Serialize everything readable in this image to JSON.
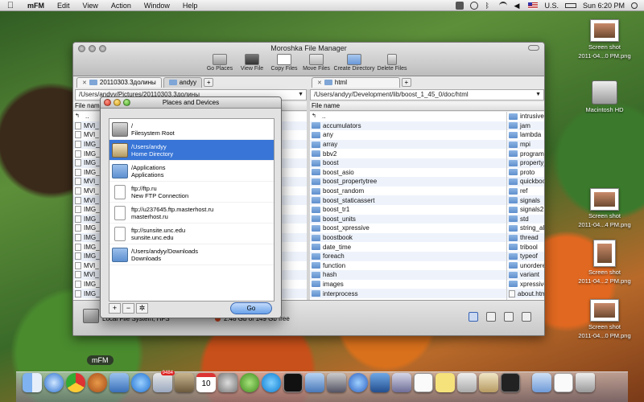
{
  "menubar": {
    "apple": "",
    "app": "mFM",
    "items": [
      "Edit",
      "View",
      "Action",
      "Window",
      "Help"
    ],
    "clock": "Sun 6:20 PM",
    "input_source": "U.S."
  },
  "window": {
    "title": "Moroshka File Manager",
    "toolbar": [
      {
        "label": "Go Places",
        "icon": "drive-icon"
      },
      {
        "label": "View File",
        "icon": "binoculars-icon"
      },
      {
        "label": "Copy Files",
        "icon": "copy-icon"
      },
      {
        "label": "Move Files",
        "icon": "move-icon"
      },
      {
        "label": "Create Directory",
        "icon": "new-folder-icon"
      },
      {
        "label": "Delete Files",
        "icon": "trash-icon"
      }
    ],
    "left": {
      "tabs": [
        "20110303.3долины",
        "andyy"
      ],
      "path": "/Users/andyy/Pictures/20110303.3долины",
      "column": "File name",
      "rows": [
        "..",
        "MVI_",
        "MVI_",
        "IMG_",
        "IMG_",
        "IMG_",
        "IMG_",
        "MVI_",
        "MVI_",
        "MVI_",
        "IMG_",
        "IMG_",
        "IMG_",
        "IMG_",
        "IMG_",
        "IMG_",
        "MVI_",
        "MVI_",
        "IMG_",
        "IMG_"
      ]
    },
    "right": {
      "tabs": [
        "html"
      ],
      "path": "/Users/andyy/Development/lib/boost_1_45_0/doc/html",
      "column": "File name",
      "col1": [
        "..",
        "accumulators",
        "any",
        "array",
        "bbv2",
        "boost",
        "boost_asio",
        "boost_propertytree",
        "boost_random",
        "boost_staticassert",
        "boost_tr1",
        "boost_units",
        "boost_xpressive",
        "boostbook",
        "date_time",
        "foreach",
        "function",
        "hash",
        "images",
        "interprocess"
      ],
      "col2": [
        "intrusive",
        "jam",
        "lambda",
        "mpi",
        "program_o",
        "property_t",
        "proto",
        "quickbook",
        "ref",
        "signals",
        "signals2",
        "std",
        "string_alg",
        "thread",
        "tribool",
        "typeof",
        "unordered",
        "variant",
        "xpressive",
        "about.html"
      ]
    },
    "status": {
      "filesystem": "Local File System, HFS",
      "free": "2.48 Gb of 149 Gb free"
    }
  },
  "dialog": {
    "title": "Places and Devices",
    "places": [
      {
        "path": "/",
        "desc": "Filesystem Root",
        "icon": "disk-icon",
        "selected": false
      },
      {
        "path": "/Users/andyy",
        "desc": "Home Directory",
        "icon": "home-icon",
        "selected": true
      },
      {
        "path": "/Applications",
        "desc": "Applications",
        "icon": "applications-icon",
        "selected": false
      },
      {
        "path": "ftp://ftp.ru",
        "desc": "New FTP Connection",
        "icon": "document-icon",
        "selected": false
      },
      {
        "path": "ftp://u237645.ftp.masterhost.ru",
        "desc": "masterhost.ru",
        "icon": "document-icon",
        "selected": false
      },
      {
        "path": "ftp://sunsite.unc.edu",
        "desc": "sunsite.unc.edu",
        "icon": "document-icon",
        "selected": false
      },
      {
        "path": "/Users/andyy/Downloads",
        "desc": "Downloads",
        "icon": "downloads-icon",
        "selected": false
      }
    ],
    "add": "+",
    "remove": "−",
    "settings": "✲",
    "go": "Go"
  },
  "desktop": [
    {
      "label1": "Screen shot",
      "label2": "2011-04...0 PM.png",
      "kind": "thumb"
    },
    {
      "label1": "Macintosh HD",
      "label2": "",
      "kind": "hd"
    },
    {
      "label1": "Screen shot",
      "label2": "2011-04...4 PM.png",
      "kind": "thumb"
    },
    {
      "label1": "Screen shot",
      "label2": "2011-04...2 PM.png",
      "kind": "thumb"
    },
    {
      "label1": "Screen shot",
      "label2": "2011-04...0 PM.png",
      "kind": "thumb"
    }
  ],
  "dock": {
    "tooltip": "mFM",
    "calendar_day": "10",
    "mail_badge": "9484"
  },
  "colors": {
    "selection": "#3875d7",
    "folder": "#6f9bd8"
  }
}
